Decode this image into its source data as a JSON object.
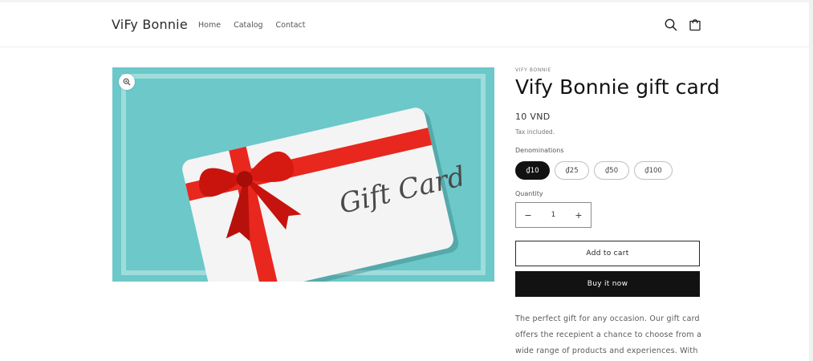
{
  "header": {
    "logo": "ViFy Bonnie",
    "nav": [
      "Home",
      "Catalog",
      "Contact"
    ],
    "search_icon": "search-icon",
    "cart_icon": "cart-icon"
  },
  "media": {
    "card_text": "Gift Card",
    "bg_color": "#6cc8c9",
    "ribbon_color": "#e8271e"
  },
  "product": {
    "vendor": "VIFY BONNIE",
    "title": "Vify Bonnie gift card",
    "price": "10 VND",
    "tax_note": "Tax included.",
    "denominations_label": "Denominations",
    "denominations": [
      "₫10",
      "₫25",
      "₫50",
      "₫100"
    ],
    "selected_denomination": "₫10",
    "quantity_label": "Quantity",
    "quantity_minus": "−",
    "quantity_value": "1",
    "quantity_plus": "+",
    "add_to_cart": "Add to cart",
    "buy_now": "Buy it now",
    "description_lines": [
      "The perfect gift for any occasion. Our gift card",
      "offers the recepient a chance to choose from a",
      "wide range of products and experiences. With"
    ]
  }
}
